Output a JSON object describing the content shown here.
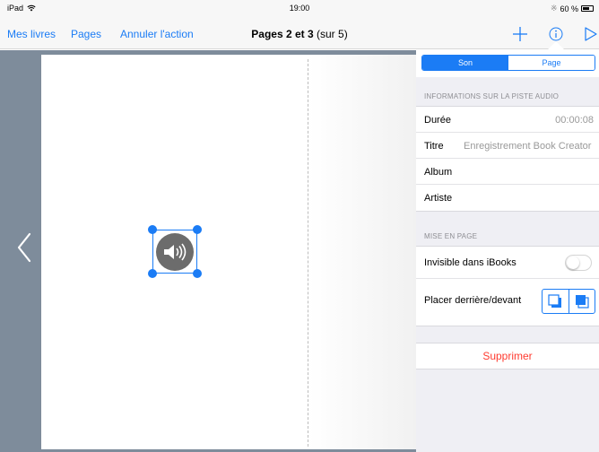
{
  "status_bar": {
    "device": "iPad",
    "time": "19:00",
    "battery": "60 %"
  },
  "nav": {
    "my_books": "Mes livres",
    "pages": "Pages",
    "undo": "Annuler l'action",
    "title_bold": "Pages 2 et 3",
    "title_rest": "(sur 5)",
    "icons": [
      "plus-icon",
      "info-icon",
      "play-icon"
    ]
  },
  "panel": {
    "tabs": [
      {
        "label": "Son",
        "active": true
      },
      {
        "label": "Page",
        "active": false
      }
    ],
    "audio_section": {
      "header": "INFORMATIONS SUR LA PISTE AUDIO",
      "duration_label": "Durée",
      "duration_value": "00:00:08",
      "title_label": "Titre",
      "title_value": "Enregistrement Book Creator",
      "album_label": "Album",
      "artist_label": "Artiste"
    },
    "layout_section": {
      "header": "MISE EN PAGE",
      "invisible_label": "Invisible dans iBooks",
      "invisible_on": false,
      "order_label": "Placer derrière/devant"
    },
    "delete_label": "Supprimer"
  },
  "colors": {
    "accent": "#1b7cf5",
    "destructive": "#ff3b30",
    "canvas_bg": "#7e8c9b"
  }
}
